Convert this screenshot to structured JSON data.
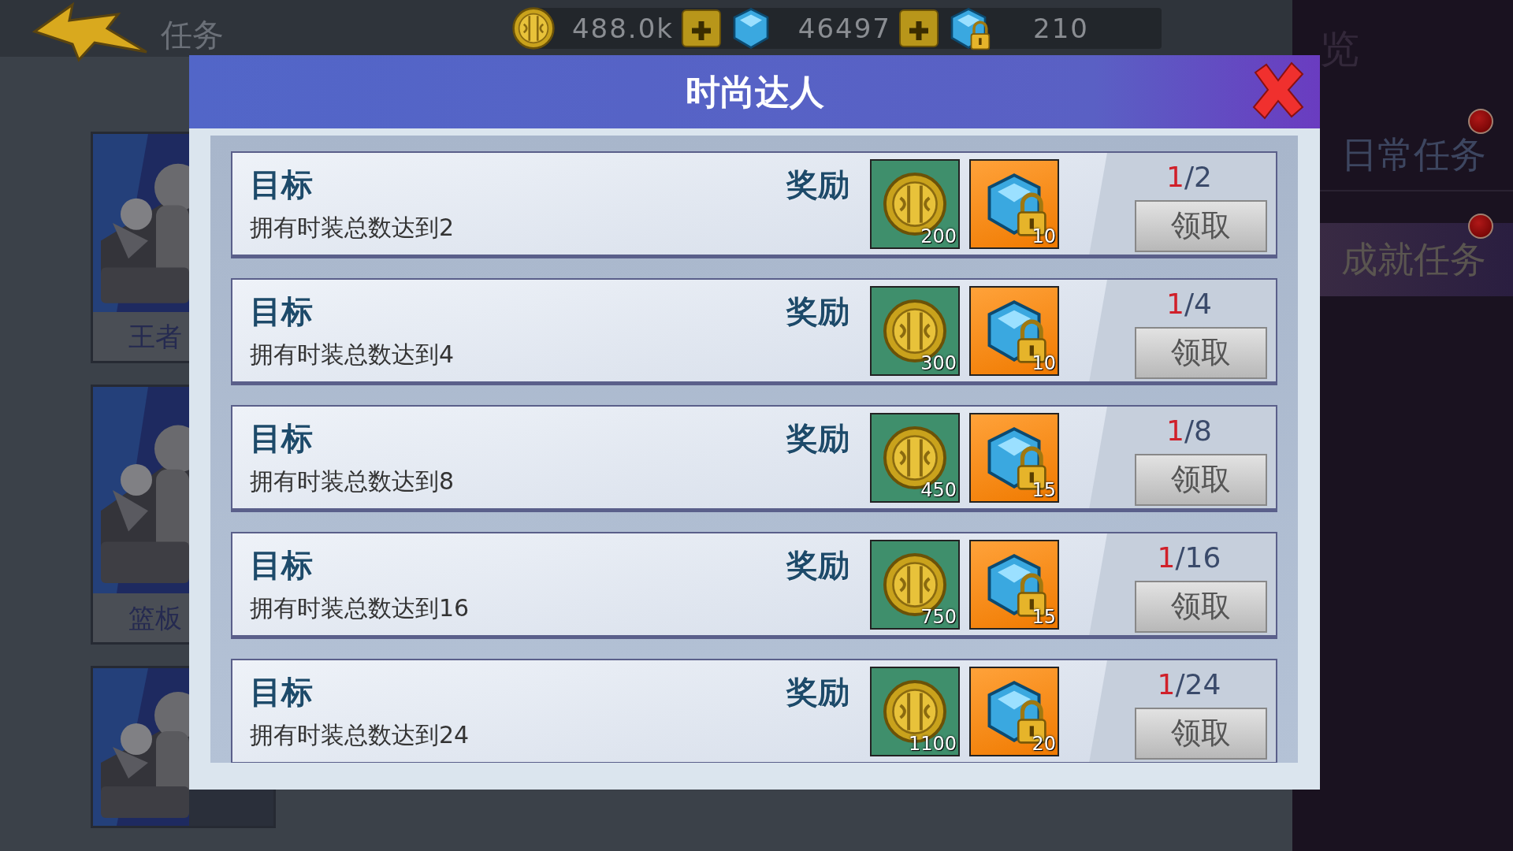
{
  "header": {
    "title": "任务"
  },
  "currencies": [
    {
      "kind": "coin",
      "value": "488.0k",
      "addable": true
    },
    {
      "kind": "gem",
      "value": "46497",
      "addable": true
    },
    {
      "kind": "locked_gem",
      "value": "210",
      "addable": false
    }
  ],
  "cards": [
    {
      "kind": "picture",
      "label": "王者"
    },
    {
      "kind": "picture",
      "label": "篮板"
    },
    {
      "kind": "picture"
    }
  ],
  "sidebar": {
    "heading": "览",
    "items": [
      {
        "label": "日常任务",
        "selected": false,
        "badge": true
      },
      {
        "label": "成就任务",
        "selected": true,
        "badge": true
      }
    ]
  },
  "dialog": {
    "title": "时尚达人",
    "tasks": [
      {
        "goal_label": "目标",
        "description": "拥有时装总数达到2",
        "reward_label": "奖励",
        "rewards": [
          {
            "kind": "coin",
            "amount": "200"
          },
          {
            "kind": "locked_gem",
            "amount": "10"
          }
        ],
        "current": "1",
        "total": "/2",
        "button": "领取"
      },
      {
        "goal_label": "目标",
        "description": "拥有时装总数达到4",
        "reward_label": "奖励",
        "rewards": [
          {
            "kind": "coin",
            "amount": "300"
          },
          {
            "kind": "locked_gem",
            "amount": "10"
          }
        ],
        "current": "1",
        "total": "/4",
        "button": "领取"
      },
      {
        "goal_label": "目标",
        "description": "拥有时装总数达到8",
        "reward_label": "奖励",
        "rewards": [
          {
            "kind": "coin",
            "amount": "450"
          },
          {
            "kind": "locked_gem",
            "amount": "15"
          }
        ],
        "current": "1",
        "total": "/8",
        "button": "领取"
      },
      {
        "goal_label": "目标",
        "description": "拥有时装总数达到16",
        "reward_label": "奖励",
        "rewards": [
          {
            "kind": "coin",
            "amount": "750"
          },
          {
            "kind": "locked_gem",
            "amount": "15"
          }
        ],
        "current": "1",
        "total": "/16",
        "button": "领取"
      },
      {
        "goal_label": "目标",
        "description": "拥有时装总数达到24",
        "reward_label": "奖励",
        "rewards": [
          {
            "kind": "coin",
            "amount": "1100"
          },
          {
            "kind": "locked_gem",
            "amount": "20"
          }
        ],
        "current": "1",
        "total": "/24",
        "button": "领取"
      }
    ]
  }
}
